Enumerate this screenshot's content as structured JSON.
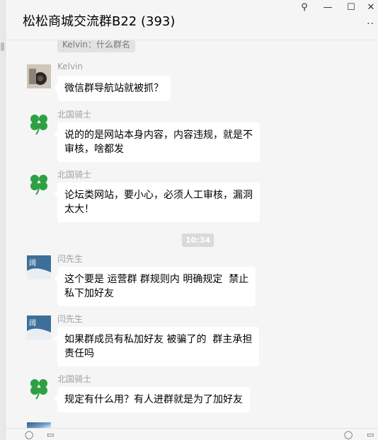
{
  "window": {
    "title": "松松商城交流群B22 (393)",
    "controls": {
      "pin": "⚲",
      "minimize": "—",
      "maximize": "☐",
      "close": "✕"
    },
    "more": "··"
  },
  "chat": {
    "top_quote": "Kelvin：什么群名",
    "time_divider": "10:34",
    "messages": [
      {
        "sender": "Kelvin",
        "avatar_icon": "photo-avatar-icon",
        "text": "微信群导航站就被抓？"
      },
      {
        "sender": "北国骑士",
        "avatar_icon": "clover-icon",
        "text_lines": [
          "说的的是网站本身内容，内容违规，就是不",
          "审核，啥都发"
        ]
      },
      {
        "sender": "北国骑士",
        "avatar_icon": "clover-icon",
        "text_lines": [
          "论坛类网站，要小心，必须人工审核，漏洞",
          "太大！"
        ]
      },
      {
        "sender": "闫先生",
        "avatar_icon": "blue-avatar-icon",
        "text_lines": [
          "这个要是 运营群 群规则内 明确规定  禁止",
          "私下加好友"
        ]
      },
      {
        "sender": "闫先生",
        "avatar_icon": "blue-avatar-icon",
        "text_lines": [
          "如果群成员有私加好友 被骗了的  群主承担",
          "责任吗"
        ]
      },
      {
        "sender": "北国骑士",
        "avatar_icon": "clover-icon",
        "text": "规定有什么用？有人进群就是为了加好友"
      }
    ]
  },
  "colors": {
    "background": "#f5f5f5",
    "bubble": "#ffffff",
    "clover": "#2ea043",
    "divider": "#dadada"
  }
}
